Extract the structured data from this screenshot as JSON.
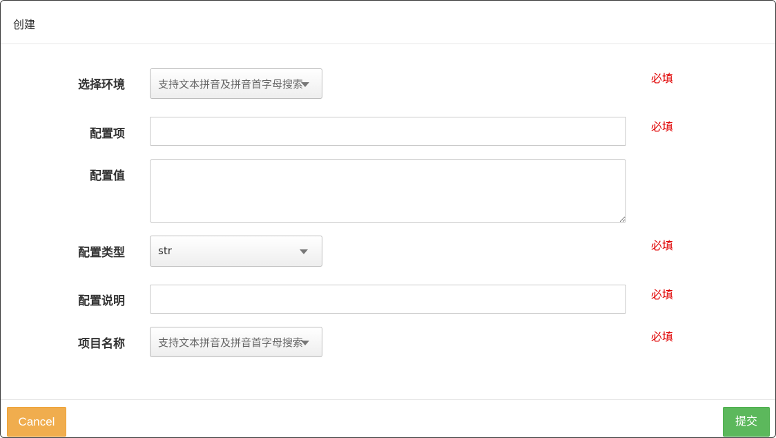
{
  "dialog": {
    "title": "创建"
  },
  "form": {
    "environment": {
      "label": "选择环境",
      "placeholder": "支持文本拼音及拼音首字母搜索",
      "hint": "必填"
    },
    "config_key": {
      "label": "配置项",
      "value": "",
      "hint": "必填"
    },
    "config_value": {
      "label": "配置值",
      "value": ""
    },
    "config_type": {
      "label": "配置类型",
      "selected": "str",
      "hint": "必填"
    },
    "config_desc": {
      "label": "配置说明",
      "value": "",
      "hint": "必填"
    },
    "project_name": {
      "label": "项目名称",
      "placeholder": "支持文本拼音及拼音首字母搜索",
      "hint": "必填"
    }
  },
  "footer": {
    "cancel_label": "Cancel",
    "submit_label": "提交"
  },
  "colors": {
    "required_hint": "#e00000",
    "cancel_button": "#f0ad4e",
    "submit_button": "#5cb85c"
  },
  "icons": {
    "dropdown": "chevron-down-icon"
  }
}
